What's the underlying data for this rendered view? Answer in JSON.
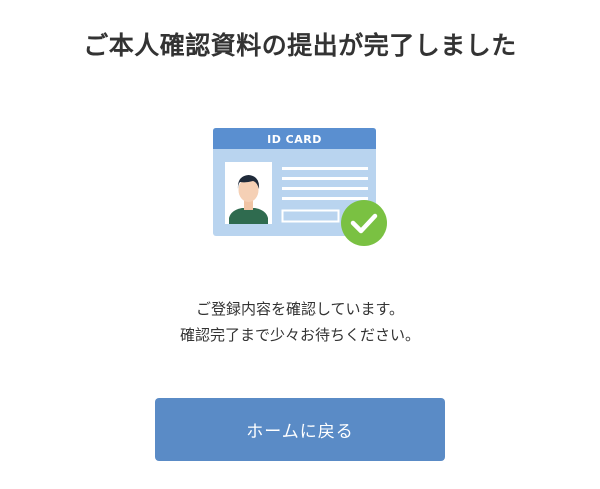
{
  "page": {
    "title": "ご本人確認資料の提出が完了しました"
  },
  "illustration": {
    "card_label": "ID CARD",
    "card_icon": "id-card-icon",
    "avatar_icon": "person-avatar-icon",
    "badge_icon": "checkmark-icon"
  },
  "message": {
    "line1": "ご登録内容を確認しています。",
    "line2": "確認完了まで少々お待ちください。"
  },
  "actions": {
    "home_label": "ホームに戻る"
  },
  "colors": {
    "primary_button": "#5a8bc6",
    "card_header": "#5a8fd0",
    "card_body": "#b9d4ef",
    "check_badge": "#7ac142",
    "title_text": "#333333"
  }
}
